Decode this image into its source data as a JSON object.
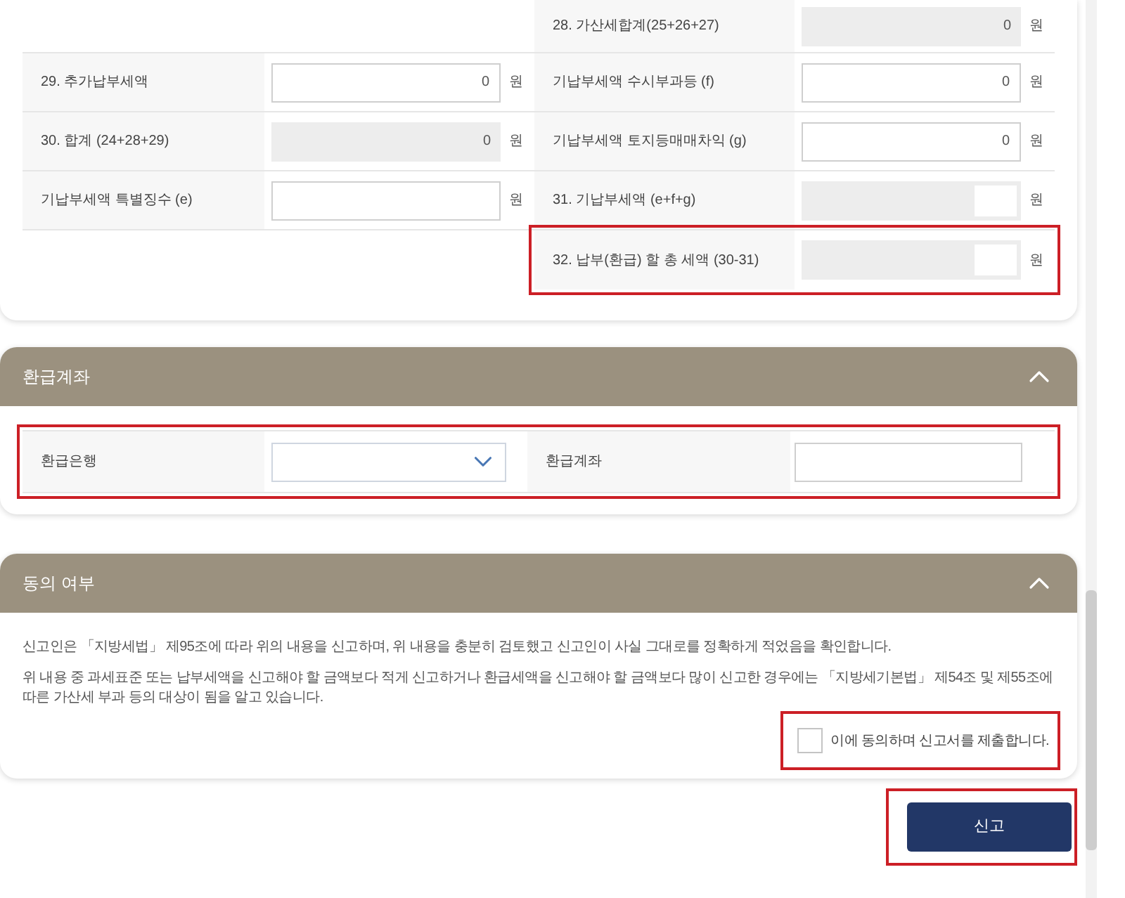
{
  "tax_table": {
    "rows": [
      {
        "right": {
          "label": "28. 가산세합계(25+26+27)",
          "value": "0",
          "unit": "원",
          "disabled": true,
          "masked": false,
          "highlighted": false
        }
      },
      {
        "left": {
          "label": "29. 추가납부세액",
          "value": "0",
          "unit": "원",
          "disabled": false,
          "masked": false,
          "highlighted": false
        },
        "right": {
          "label": "기납부세액 수시부과등 (f)",
          "value": "0",
          "unit": "원",
          "disabled": false,
          "masked": false,
          "highlighted": false
        }
      },
      {
        "left": {
          "label": "30. 합계 (24+28+29)",
          "value": "0",
          "unit": "원",
          "disabled": true,
          "masked": false,
          "highlighted": false
        },
        "right": {
          "label": "기납부세액 토지등매매차익 (g)",
          "value": "0",
          "unit": "원",
          "disabled": false,
          "masked": false,
          "highlighted": false
        }
      },
      {
        "left": {
          "label": "기납부세액 특별징수 (e)",
          "unit": "원",
          "disabled": false,
          "masked": false,
          "highlighted": false
        },
        "right": {
          "label": "31. 기납부세액 (e+f+g)",
          "unit": "원",
          "disabled": true,
          "masked": true,
          "highlighted": false
        }
      },
      {
        "right": {
          "label": "32. 납부(환급) 할 총 세액 (30-31)",
          "unit": "원",
          "disabled": true,
          "masked": true,
          "highlighted": true
        }
      }
    ]
  },
  "refund_account": {
    "title": "환급계좌",
    "expanded": true,
    "highlighted": true,
    "bank": {
      "label": "환급은행"
    },
    "account": {
      "label": "환급계좌"
    }
  },
  "consent": {
    "title": "동의 여부",
    "expanded": true,
    "paragraphs": [
      "신고인은 「지방세법」 제95조에 따라 위의 내용을 신고하며, 위 내용을 충분히 검토했고 신고인이 사실 그대로를 정확하게 적었음을 확인합니다.",
      "위 내용 중 과세표준 또는 납부세액을 신고해야 할 금액보다 적게 신고하거나 환급세액을 신고해야 할 금액보다 많이 신고한 경우에는 「지방세기본법」 제54조 및 제55조에 따른 가산세 부과 등의 대상이 됨을 알고 있습니다."
    ],
    "agree": {
      "label": "이에 동의하며 신고서를 제출합니다.",
      "checked": false,
      "highlighted": true
    }
  },
  "submit": {
    "label": "신고",
    "highlighted": true
  }
}
